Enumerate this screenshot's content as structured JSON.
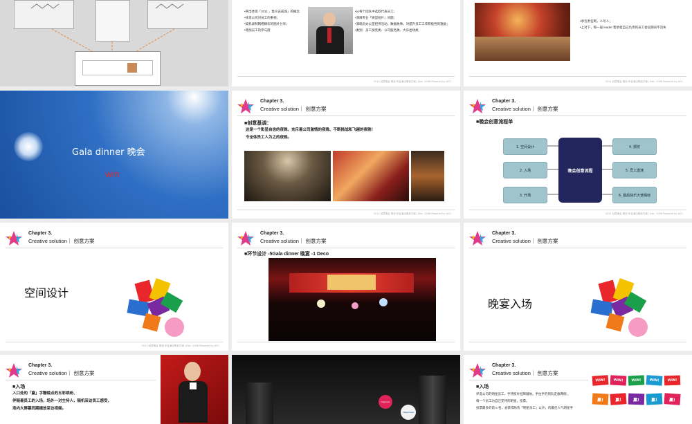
{
  "common": {
    "chapter": "Chapter 3.",
    "subtitle": "Creative solution｜ 创意方案",
    "footer": "2011 创意晚会 策划 年会演出策划方案 | Dec. 2006 Powered by ACC."
  },
  "slide_r0c1": {
    "bullets_left": [
      "•突出体现「2011 ，集众志成城」的概念",
      "•体现公司对员工的重视；",
      "•契机录制网络精彩的图片分享；",
      "•增加员工的参与度"
    ],
    "bullets_right": [
      "•从每个团队中选取代表员工；",
      "•演绎专业「微型短片」问题；",
      "•演唱员办公室招待活动，数据故事，对提升员工工作积极性的激励；",
      "•类别：员工加奖类、公司服务类、大乐出场类"
    ]
  },
  "slide_r0c2": {
    "bullets": [
      "•承包责任制，人尽人；",
      "•上对下，每一届 leader 需承担自己负责的员工会议期间不流失"
    ]
  },
  "slide_r1c0": {
    "title": "Gala dinner  晚会",
    "tag": "win"
  },
  "slide_r1c1": {
    "section": "■创意基调：",
    "lines": [
      "这是一个彰显自信的夜晚、充斥着公司激情的夜晚、不断挑战和飞越的夜晚！",
      "令全体员工人为之的夜晚。"
    ]
  },
  "slide_r1c2": {
    "section": "■晚会创意流程单",
    "left_boxes": [
      "1. 空间设计",
      "2. 入场",
      "3. 开场"
    ],
    "center": "晚会创意流程",
    "right_boxes": [
      "4. 颁奖",
      "5. 员工激演",
      "6. 最后快乐大使揭晓"
    ]
  },
  "slide_r2c0": {
    "title": "空间设计"
  },
  "slide_r2c1": {
    "section": "■环节设计 -5Gala dinner  晚宴 -1 Deco"
  },
  "slide_r2c2": {
    "title": "晚宴入场"
  },
  "slide_r3c0": {
    "section": "■入场",
    "lines": [
      "入口处的「赢」字鞭缕点的五彩缤纷、",
      "伴随着员工的入场，场外一对主持人，随机采访员工感受，",
      "场内大屏幕同期播放采访视频。"
    ]
  },
  "slide_r3c1": {
    "badge1": "Happiness",
    "badge2": "Happiness"
  },
  "slide_r3c2": {
    "section": "■入场",
    "lines": [
      "评选公司的明星员工，手持照片招牌踏地，手拉手的到队走廊两侧，",
      "每一个员工为自己支持的明星，投票。",
      "投票最多的前 5 名，会获得除去「明星员工」以外，的最佳人气明星手"
    ],
    "signs_top": [
      "WIN!",
      "WIN!",
      "WIN!",
      "WIN!",
      "WIN!"
    ],
    "signs_bottom": [
      "赢!",
      "赢!",
      "赢!",
      "赢!",
      "赢!"
    ]
  }
}
